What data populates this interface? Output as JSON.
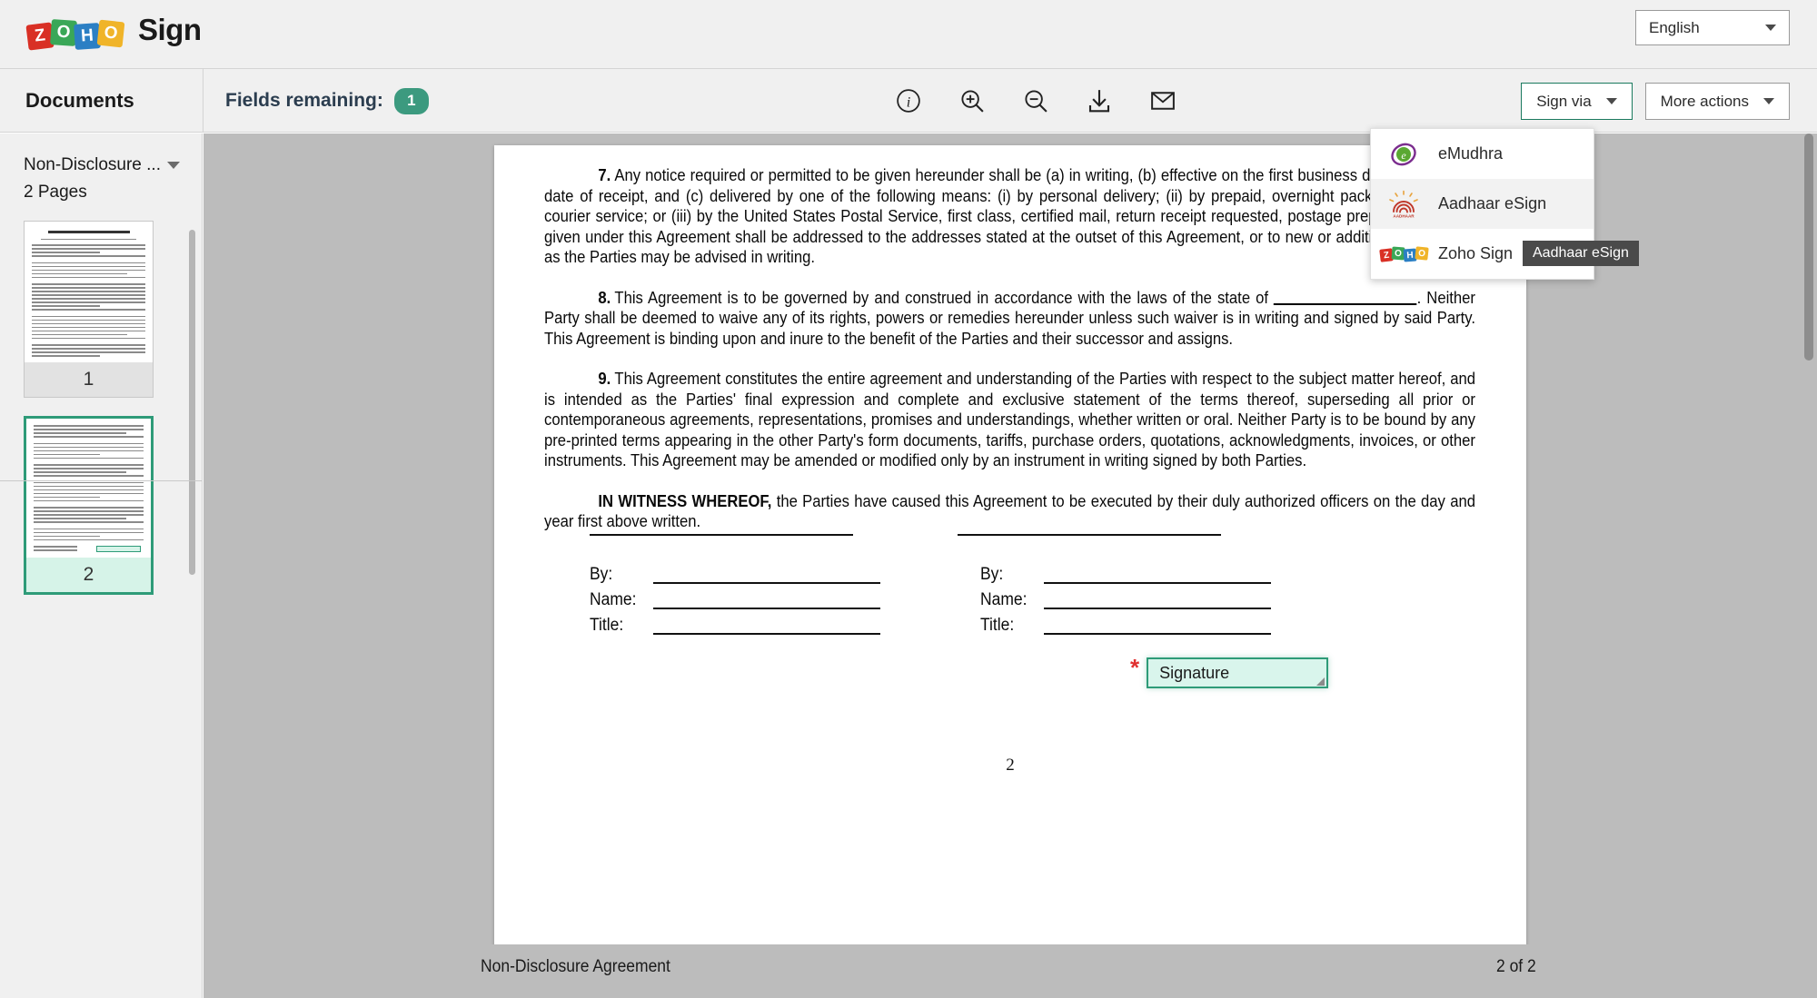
{
  "header": {
    "brand_zoho": "ZOHO",
    "brand_letters": [
      "Z",
      "O",
      "H",
      "O"
    ],
    "brand_product": "Sign",
    "language": "English",
    "language_caret": "chevron-down-icon"
  },
  "toolbar": {
    "documents_label": "Documents",
    "fields_remaining_label": "Fields remaining:",
    "fields_remaining_count": "1",
    "icons": [
      "info-icon",
      "zoom-in-icon",
      "zoom-out-icon",
      "download-icon",
      "email-icon"
    ],
    "sign_via_label": "Sign via",
    "more_actions_label": "More actions"
  },
  "sign_via_menu": {
    "items": [
      {
        "label": "eMudhra",
        "icon": "emudhra-logo-icon",
        "hovered": false
      },
      {
        "label": "Aadhaar eSign",
        "icon": "aadhaar-logo-icon",
        "hovered": true
      },
      {
        "label": "Zoho Sign",
        "icon": "zoho-logo-icon",
        "hovered": false
      }
    ],
    "tooltip": "Aadhaar eSign"
  },
  "sidebar": {
    "document_name": "Non-Disclosure ...",
    "page_count_label": "2 Pages",
    "thumbnails": [
      {
        "number": "1",
        "selected": false
      },
      {
        "number": "2",
        "selected": true
      }
    ]
  },
  "document": {
    "paragraphs": [
      {
        "number": "7.",
        "text": "Any notice required or permitted to be given hereunder shall be (a) in writing, (b) effective on the first business day following the date of receipt, and (c) delivered by one of the following means: (i) by personal delivery; (ii) by prepaid, overnight package delivery or courier service; or (iii) by the United States Postal Service, first class, certified mail, return receipt requested, postage prepaid.  All notices given under this Agreement shall be addressed to the addresses stated at the outset of this Agreement, or to new or additional addresses as the Parties may be advised in writing."
      },
      {
        "number": "8.",
        "text_before_blank": "This Agreement is to be governed by and construed in accordance with the laws of the state of ",
        "text_after_blank": ".  Neither Party shall be deemed to waive any of its rights, powers or remedies hereunder unless such waiver is in writing and signed by said Party.  This Agreement is binding upon and inure to the benefit of the Parties and their successor and assigns."
      },
      {
        "number": "9.",
        "text": "This Agreement constitutes the entire agreement and understanding of the Parties with respect to the subject matter hereof, and is intended as the Parties' final expression and complete and exclusive statement of the terms thereof, superseding all prior or contemporaneous agreements, representations, promises and understandings, whether written or oral.  Neither Party is to be bound by any pre-printed terms appearing in the other Party's form documents, tariffs, purchase orders, quotations, acknowledgments, invoices, or other instruments.  This Agreement may be amended or modified only by an instrument in writing signed by both Parties."
      }
    ],
    "witness_bold": "IN WITNESS WHEREOF,",
    "witness_rest": " the Parties have caused this Agreement to be executed by their duly authorized officers on the day and year first above written.",
    "signature_labels": [
      "By:",
      "Name:",
      "Title:"
    ],
    "signature_field_label": "Signature",
    "signature_field_required": "*",
    "page_number_printed": "2"
  },
  "footer": {
    "document_title": "Non-Disclosure Agreement",
    "page_position": "2 of 2"
  },
  "colors": {
    "accent_teal": "#2e9b78",
    "badge_green": "#3c9a7f",
    "field_fill": "#d9f5ec",
    "required_red": "#e03030",
    "viewer_gray": "#bcbcbc",
    "chrome_gray": "#f0f0f0"
  }
}
